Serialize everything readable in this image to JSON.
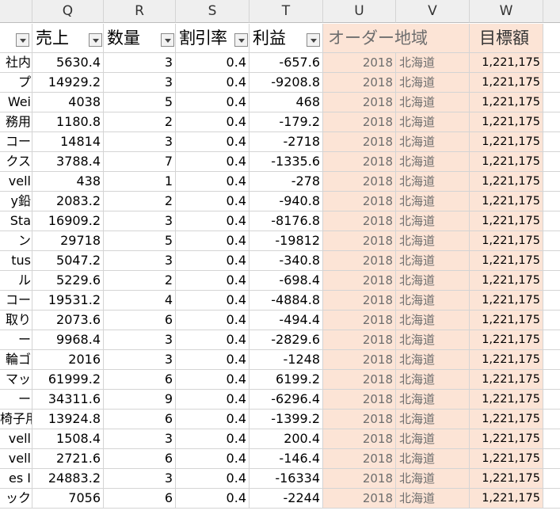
{
  "columns": [
    "",
    "Q",
    "R",
    "S",
    "T",
    "U",
    "V",
    "W",
    ""
  ],
  "headers": {
    "left_clip": "",
    "q": "売上",
    "r": "数量",
    "s": "割引率",
    "t": "利益",
    "uv": "オーダー地域",
    "w": "目標額"
  },
  "rows": [
    {
      "p": "社内",
      "q": "5630.4",
      "r": "3",
      "s": "0.4",
      "t": "-657.6",
      "u": "2018",
      "v": "北海道",
      "w": "1,221,175"
    },
    {
      "p": "プ",
      "q": "14929.2",
      "r": "3",
      "s": "0.4",
      "t": "-9208.8",
      "u": "2018",
      "v": "北海道",
      "w": "1,221,175"
    },
    {
      "p": "Wei",
      "q": "4038",
      "r": "5",
      "s": "0.4",
      "t": "468",
      "u": "2018",
      "v": "北海道",
      "w": "1,221,175"
    },
    {
      "p": "務用",
      "q": "1180.8",
      "r": "2",
      "s": "0.4",
      "t": "-179.2",
      "u": "2018",
      "v": "北海道",
      "w": "1,221,175"
    },
    {
      "p": "コー",
      "q": "14814",
      "r": "3",
      "s": "0.4",
      "t": "-2718",
      "u": "2018",
      "v": "北海道",
      "w": "1,221,175"
    },
    {
      "p": "クス",
      "q": "3788.4",
      "r": "7",
      "s": "0.4",
      "t": "-1335.6",
      "u": "2018",
      "v": "北海道",
      "w": "1,221,175"
    },
    {
      "p": "vell",
      "q": "438",
      "r": "1",
      "s": "0.4",
      "t": "-278",
      "u": "2018",
      "v": "北海道",
      "w": "1,221,175"
    },
    {
      "p": "y鉛",
      "q": "2083.2",
      "r": "2",
      "s": "0.4",
      "t": "-940.8",
      "u": "2018",
      "v": "北海道",
      "w": "1,221,175"
    },
    {
      "p": "Sta",
      "q": "16909.2",
      "r": "3",
      "s": "0.4",
      "t": "-8176.8",
      "u": "2018",
      "v": "北海道",
      "w": "1,221,175"
    },
    {
      "p": "ン",
      "q": "29718",
      "r": "5",
      "s": "0.4",
      "t": "-19812",
      "u": "2018",
      "v": "北海道",
      "w": "1,221,175"
    },
    {
      "p": "tus",
      "q": "5047.2",
      "r": "3",
      "s": "0.4",
      "t": "-340.8",
      "u": "2018",
      "v": "北海道",
      "w": "1,221,175"
    },
    {
      "p": "ル",
      "q": "5229.6",
      "r": "2",
      "s": "0.4",
      "t": "-698.4",
      "u": "2018",
      "v": "北海道",
      "w": "1,221,175"
    },
    {
      "p": "コー",
      "q": "19531.2",
      "r": "4",
      "s": "0.4",
      "t": "-4884.8",
      "u": "2018",
      "v": "北海道",
      "w": "1,221,175"
    },
    {
      "p": "取り",
      "q": "2073.6",
      "r": "6",
      "s": "0.4",
      "t": "-494.4",
      "u": "2018",
      "v": "北海道",
      "w": "1,221,175"
    },
    {
      "p": "ー",
      "q": "9968.4",
      "r": "3",
      "s": "0.4",
      "t": "-2829.6",
      "u": "2018",
      "v": "北海道",
      "w": "1,221,175"
    },
    {
      "p": "輪ゴ",
      "q": "2016",
      "r": "3",
      "s": "0.4",
      "t": "-1248",
      "u": "2018",
      "v": "北海道",
      "w": "1,221,175"
    },
    {
      "p": "マッ",
      "q": "61999.2",
      "r": "6",
      "s": "0.4",
      "t": "6199.2",
      "u": "2018",
      "v": "北海道",
      "w": "1,221,175"
    },
    {
      "p": "ー",
      "q": "34311.6",
      "r": "9",
      "s": "0.4",
      "t": "-6296.4",
      "u": "2018",
      "v": "北海道",
      "w": "1,221,175"
    },
    {
      "p": "椅子用",
      "q": "13924.8",
      "r": "6",
      "s": "0.4",
      "t": "-1399.2",
      "u": "2018",
      "v": "北海道",
      "w": "1,221,175"
    },
    {
      "p": "vell",
      "q": "1508.4",
      "r": "3",
      "s": "0.4",
      "t": "200.4",
      "u": "2018",
      "v": "北海道",
      "w": "1,221,175"
    },
    {
      "p": "vell",
      "q": "2721.6",
      "r": "6",
      "s": "0.4",
      "t": "-146.4",
      "u": "2018",
      "v": "北海道",
      "w": "1,221,175"
    },
    {
      "p": "es I",
      "q": "24883.2",
      "r": "3",
      "s": "0.4",
      "t": "-16334",
      "u": "2018",
      "v": "北海道",
      "w": "1,221,175"
    },
    {
      "p": "ック",
      "q": "7056",
      "r": "6",
      "s": "0.4",
      "t": "-2244",
      "u": "2018",
      "v": "北海道",
      "w": "1,221,175"
    }
  ],
  "colors": {
    "peach": "#fce4d6",
    "header_bg": "#efefef",
    "grid": "#d4d4d4"
  }
}
